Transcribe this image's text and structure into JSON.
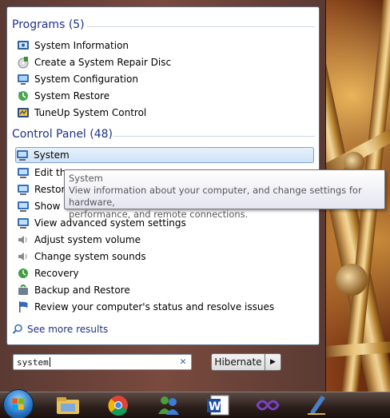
{
  "start_menu": {
    "programs": {
      "title": "Programs (5)",
      "items": [
        {
          "label": "System Information",
          "icon": "system-information-icon"
        },
        {
          "label": "Create a System Repair Disc",
          "icon": "repair-disc-icon"
        },
        {
          "label": "System Configuration",
          "icon": "system-configuration-icon"
        },
        {
          "label": "System Restore",
          "icon": "system-restore-icon"
        },
        {
          "label": "TuneUp System Control",
          "icon": "tuneup-icon"
        }
      ]
    },
    "control_panel": {
      "title": "Control Panel (48)",
      "items": [
        {
          "label": "System",
          "icon": "computer-icon",
          "selected": true
        },
        {
          "label": "Edit the",
          "icon": "computer-icon"
        },
        {
          "label": "Restor",
          "icon": "computer-icon"
        },
        {
          "label": "Show",
          "icon": "computer-icon"
        },
        {
          "label": "View advanced system settings",
          "icon": "computer-icon"
        },
        {
          "label": "Adjust system volume",
          "icon": "speaker-icon"
        },
        {
          "label": "Change system sounds",
          "icon": "speaker-icon"
        },
        {
          "label": "Recovery",
          "icon": "recovery-icon"
        },
        {
          "label": "Backup and Restore",
          "icon": "backup-icon"
        },
        {
          "label": "Review your computer's status and resolve issues",
          "icon": "flag-icon"
        }
      ]
    },
    "see_more": "See more results",
    "search": {
      "value": "system"
    },
    "power_button": "Hibernate"
  },
  "tooltip": {
    "title": "System",
    "line1": "View information about your computer, and change settings for hardware,",
    "line2": "performance, and remote connections."
  },
  "taskbar": {
    "icons": [
      "start-orb-icon",
      "file-explorer-icon",
      "chrome-icon",
      "messenger-icon",
      "word-icon",
      "visual-studio-icon",
      "pen-app-icon"
    ]
  }
}
